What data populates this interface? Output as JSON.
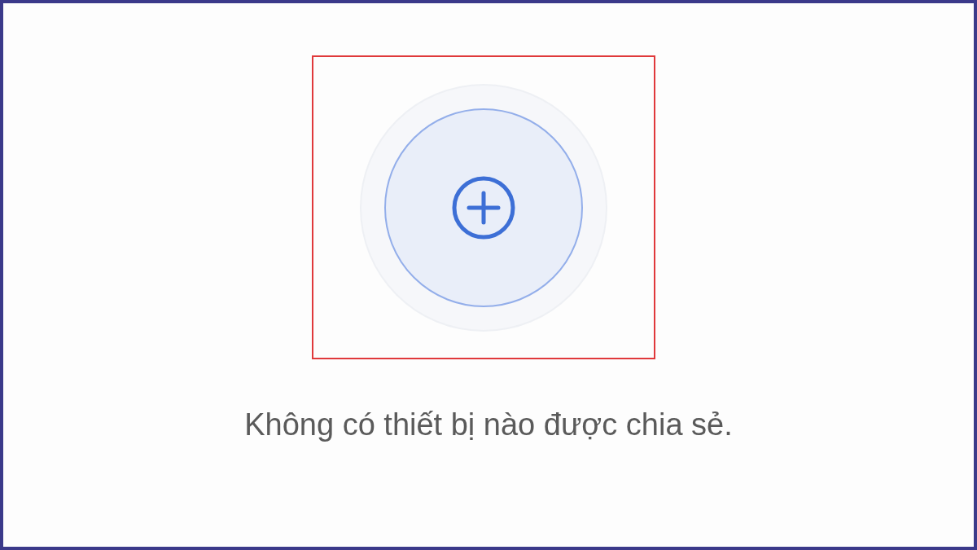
{
  "empty_state": {
    "message": "Không có thiết bị nào được chia sẻ."
  }
}
